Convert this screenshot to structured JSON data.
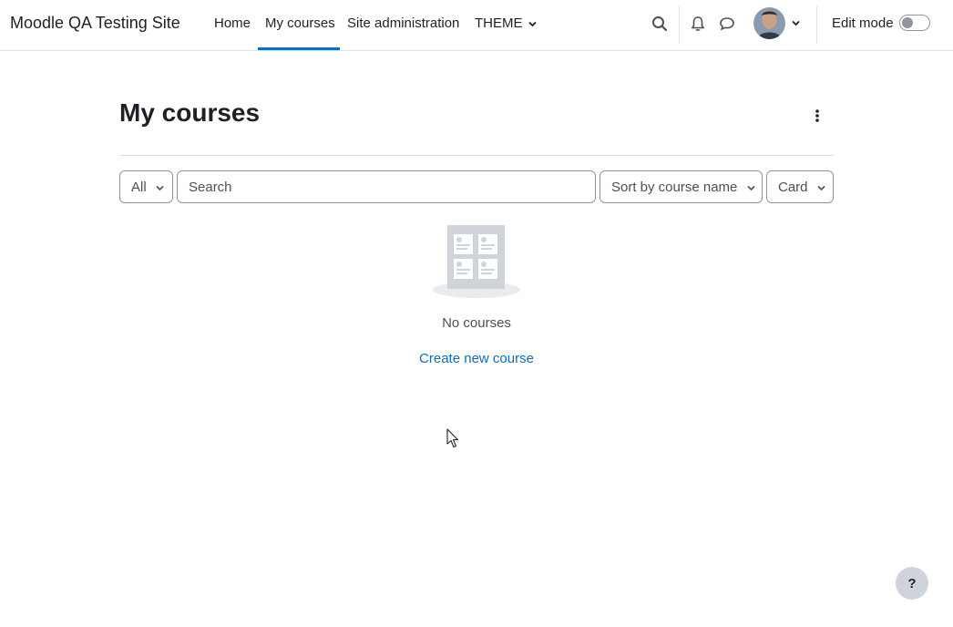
{
  "navbar": {
    "brand": "Moodle QA Testing Site",
    "links": [
      {
        "label": "Home"
      },
      {
        "label": "My courses",
        "active": true
      },
      {
        "label": "Site administration"
      },
      {
        "label": "THEME"
      }
    ],
    "icons": [
      "search-icon",
      "bell-icon",
      "chat-icon"
    ],
    "edit_mode_label": "Edit mode",
    "edit_mode_on": false
  },
  "main": {
    "title": "My courses",
    "filters": {
      "grouping_selected": "All",
      "search_placeholder": "Search",
      "sort_selected": "Sort by course name",
      "view_selected": "Card"
    },
    "empty_state": {
      "message": "No courses",
      "create_link": "Create new course"
    }
  },
  "help_button": "?",
  "colors": {
    "accent": "#0f6cbf",
    "border": "#8f959e",
    "muted_text": "#495057"
  }
}
